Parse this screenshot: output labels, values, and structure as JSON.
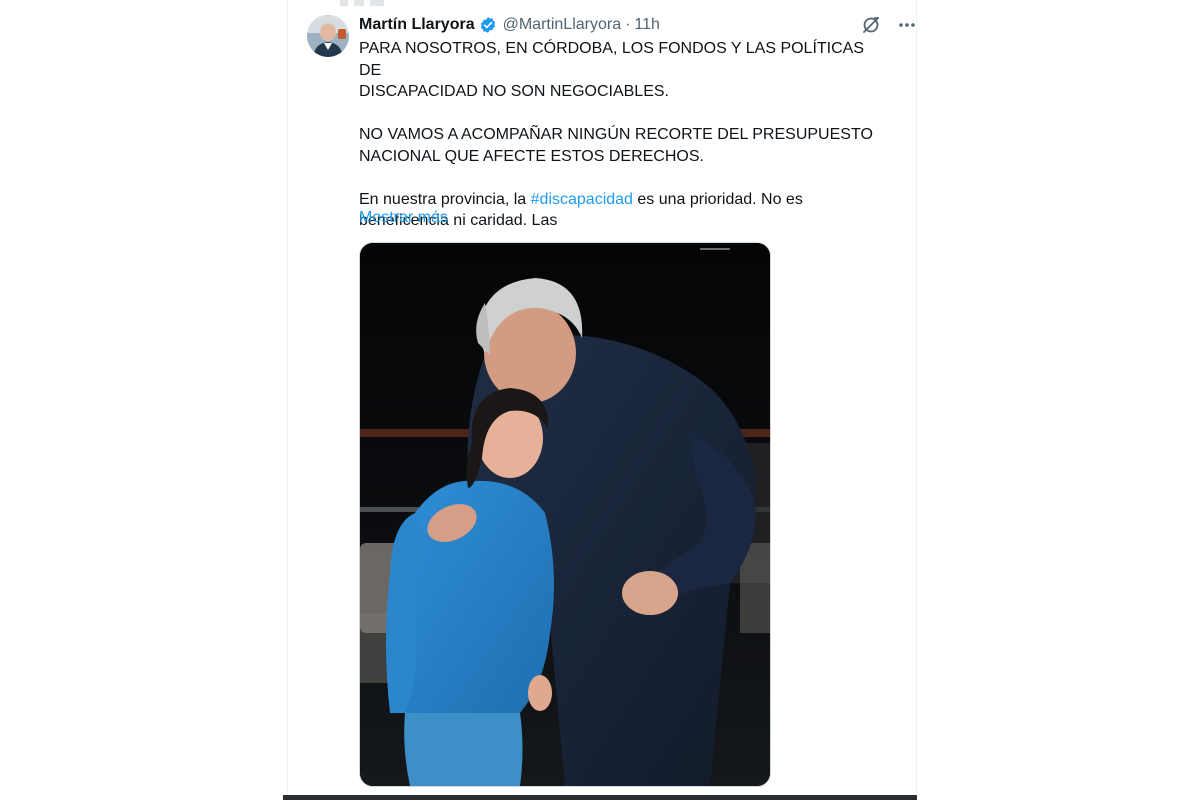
{
  "tweet": {
    "author_name": "Martín Llaryora",
    "handle": "@MartinLlaryora",
    "separator": "·",
    "time": "11h",
    "paragraphs": [
      [
        "PARA NOSOTROS, EN CÓRDOBA, LOS FONDOS Y LAS POLÍTICAS DE",
        "DISCAPACIDAD NO SON NEGOCIABLES."
      ],
      [
        "NO VAMOS A ACOMPAÑAR NINGÚN RECORTE DEL PRESUPUESTO",
        "NACIONAL QUE AFECTE ESTOS DERECHOS."
      ]
    ],
    "line3_before": "En nuestra provincia, la ",
    "hashtag": "#discapacidad",
    "line3_after": " es una prioridad. No es",
    "line4": "beneficencia ni caridad. Las",
    "show_more": "Mostrar más",
    "verified_color": "#1d9bf0",
    "link_color": "#1d9bf0"
  },
  "icons": {
    "verified": "verified-badge-icon",
    "grok": "grok-icon",
    "more": "more-options-icon"
  }
}
